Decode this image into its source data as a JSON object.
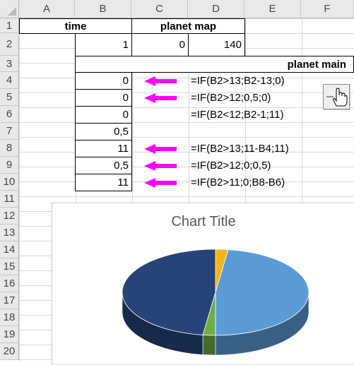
{
  "columns": [
    "A",
    "B",
    "C",
    "D",
    "E",
    "F"
  ],
  "rows": [
    "1",
    "2",
    "3",
    "4",
    "5",
    "6",
    "7",
    "8",
    "9",
    "10",
    "11",
    "12",
    "13",
    "14",
    "15",
    "16",
    "17",
    "18",
    "19",
    "20"
  ],
  "headers": {
    "time": "time",
    "planet_map": "planet map",
    "planet_main": "planet main"
  },
  "values": {
    "B2": "1",
    "C2": "0",
    "D2": "140",
    "B4": "0",
    "B5": "0",
    "B6": "0",
    "B7": "0,5",
    "B8": "11",
    "B9": "0,5",
    "B10": "11"
  },
  "formulas": {
    "D4": "=IF(B2>13;B2-13;0)",
    "D5": "=IF(B2>12;0,5;0)",
    "D6": "=IF(B2<12;B2-1;11)",
    "D8": "=IF(B2>13;11-B4;11)",
    "D9": "=IF(B2>12;0;0,5)",
    "D10": "=IF(B2>11;0;B8-B6)"
  },
  "arrow_color": "#ff00ff",
  "arrows_on_rows": [
    "4",
    "5",
    "8",
    "9",
    "10"
  ],
  "chart": {
    "title": "Chart Title"
  },
  "chart_data": {
    "type": "pie",
    "title": "Chart Title",
    "three_d": true,
    "values": [
      0.5,
      11,
      0.5,
      11
    ],
    "slice_colors": [
      "#f2b418",
      "#5b9bd5",
      "#70ad47",
      "#264478"
    ]
  }
}
